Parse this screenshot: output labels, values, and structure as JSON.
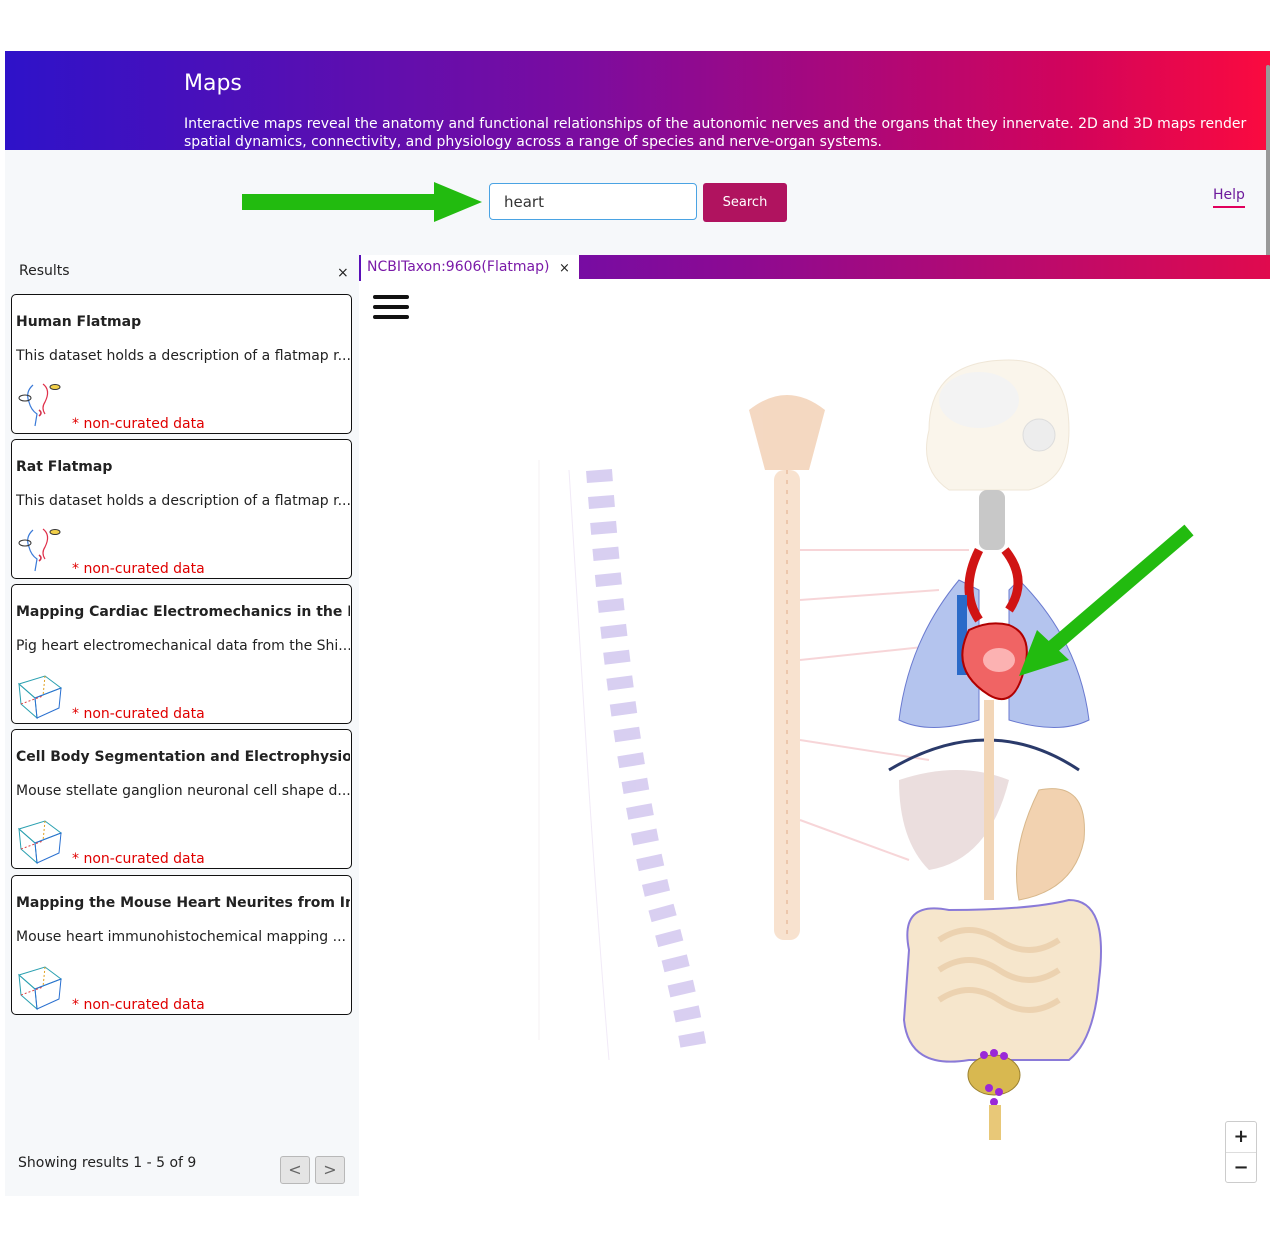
{
  "header": {
    "title": "Maps",
    "description": "Interactive maps reveal the anatomy and functional relationships of the autonomic nerves and the organs that they innervate. 2D and 3D maps render spatial dynamics, connectivity, and physiology across a range of species and nerve-organ systems."
  },
  "search": {
    "value": "heart",
    "button_label": "Search"
  },
  "help_label": "Help",
  "results": {
    "title": "Results",
    "close": "×",
    "items": [
      {
        "title": "Human Flatmap",
        "description": "This dataset holds a description of a flatmap r...",
        "tag": "* non-curated data",
        "thumb": "face-flatmap-icon"
      },
      {
        "title": "Rat Flatmap",
        "description": "This dataset holds a description of a flatmap r...",
        "tag": "* non-curated data",
        "thumb": "face-flatmap-icon"
      },
      {
        "title": "Mapping Cardiac Electromechanics in the Pig",
        "description": "Pig heart electromechanical data from the Shi...",
        "tag": "* non-curated data",
        "thumb": "cube-3d-icon"
      },
      {
        "title": "Cell Body Segmentation and Electrophysiolog...",
        "description": "Mouse stellate ganglion neuronal cell shape d...",
        "tag": "* non-curated data",
        "thumb": "cube-3d-icon"
      },
      {
        "title": "Mapping the Mouse Heart Neurites from Imag...",
        "description": "Mouse heart immunohistochemical mapping ...",
        "tag": "* non-curated data",
        "thumb": "cube-3d-icon"
      }
    ],
    "pagination": {
      "text": "Showing results 1 - 5 of 9",
      "prev": "<",
      "next": ">"
    }
  },
  "map": {
    "tab_label": "NCBITaxon:9606(Flatmap)",
    "tab_close": "×",
    "zoom_in": "+",
    "zoom_out": "−"
  },
  "colors": {
    "header_gradient_start": "#2e12c9",
    "header_gradient_end": "#fb0a3f",
    "search_button": "#b0135f",
    "annotation_arrow": "#22bb0f",
    "non_curated_tag": "#e00000"
  }
}
